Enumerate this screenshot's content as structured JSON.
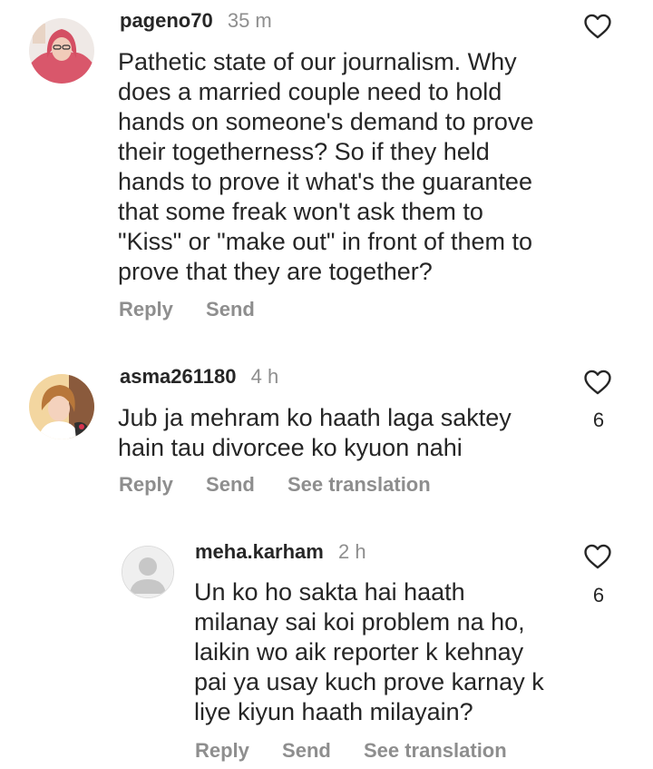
{
  "comments": [
    {
      "username": "pageno70",
      "time": "35 m",
      "lines": [
        "Pathetic state of our journalism. Why",
        "does a married couple need to hold",
        "hands on someone's demand to prove",
        "their togetherness? So if they held",
        "hands to prove it what's the guarantee",
        "that some freak won't ask them to",
        "\"Kiss\" or \"make out\" in front of them to",
        "prove that they are together?"
      ],
      "actions": {
        "reply": "Reply",
        "send": "Send"
      }
    },
    {
      "username": "asma261180",
      "time": "4 h",
      "likes": "6",
      "lines": [
        "Jub ja mehram ko haath laga saktey",
        "hain tau divorcee ko kyuon nahi"
      ],
      "actions": {
        "reply": "Reply",
        "send": "Send",
        "translate": "See translation"
      }
    },
    {
      "username": "meha.karham",
      "time": "2 h",
      "likes": "6",
      "lines": [
        "Un ko ho sakta hai haath",
        "milanay sai koi problem na ho,",
        "laikin wo aik reporter k kehnay",
        "pai ya usay kuch prove karnay k",
        "liye kiyun haath milayain?"
      ],
      "actions": {
        "reply": "Reply",
        "send": "Send",
        "translate": "See translation"
      }
    }
  ],
  "colors": {
    "text": "#262626",
    "secondary": "#8e8e8e",
    "background": "#ffffff"
  },
  "icons": {
    "like": "heart-outline-icon",
    "default_avatar": "default-avatar-icon"
  }
}
